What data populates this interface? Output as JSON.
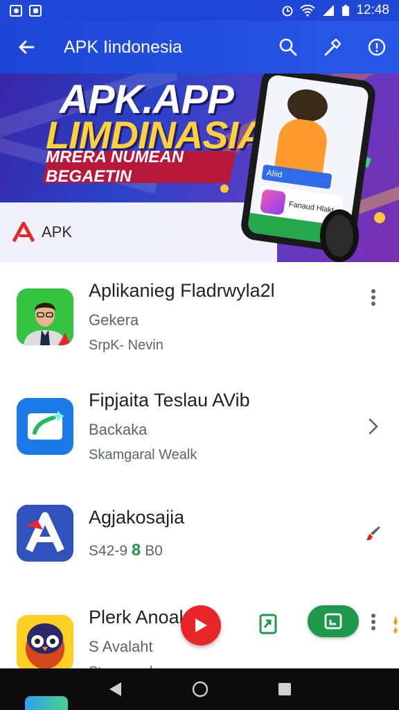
{
  "status_bar": {
    "time": "12:48"
  },
  "app_bar": {
    "title": "APK Iindonesia",
    "back_icon": "arrow-back-icon",
    "actions": [
      "search-icon",
      "hammer-icon",
      "info-icon"
    ]
  },
  "banner": {
    "headline_line1": "APK.APP",
    "headline_line2": "LIMDINASIA",
    "ribbon_text": "MRERA NUMEAN BEGAETIN",
    "logo_text": "APK",
    "phone_tag": "Aliid",
    "phone_card_text": "Fanaud Hlakt"
  },
  "apps": [
    {
      "name": "Aplikanieg Fladrwyla2l",
      "subtitle": "Gekera",
      "meta": "SrpK- Nevin",
      "trailing": "more-vert-icon",
      "icon": "man-avatar-icon"
    },
    {
      "name": "Fipjaita Teslau AVib",
      "subtitle": "Backaka",
      "meta": "Skamgaral Wealk",
      "trailing": "chevron-right-icon",
      "icon": "cast-icon"
    },
    {
      "name": "Agjakosajia",
      "subtitle": "",
      "meta_prefix": "S42-9",
      "meta_highlight": "8",
      "meta_suffix": "B0",
      "trailing": "brush-icon",
      "icon": "apk-a-icon"
    },
    {
      "name": "Plerk Anoal",
      "subtitle": "S Avalaht",
      "meta": "Stranapral",
      "trailing": "more-vert-icon",
      "icon": "owl-icon"
    }
  ],
  "colors": {
    "app_bar": "#1e47d8",
    "fab_red": "#e8262a",
    "accent_green": "#1f9a4c"
  }
}
